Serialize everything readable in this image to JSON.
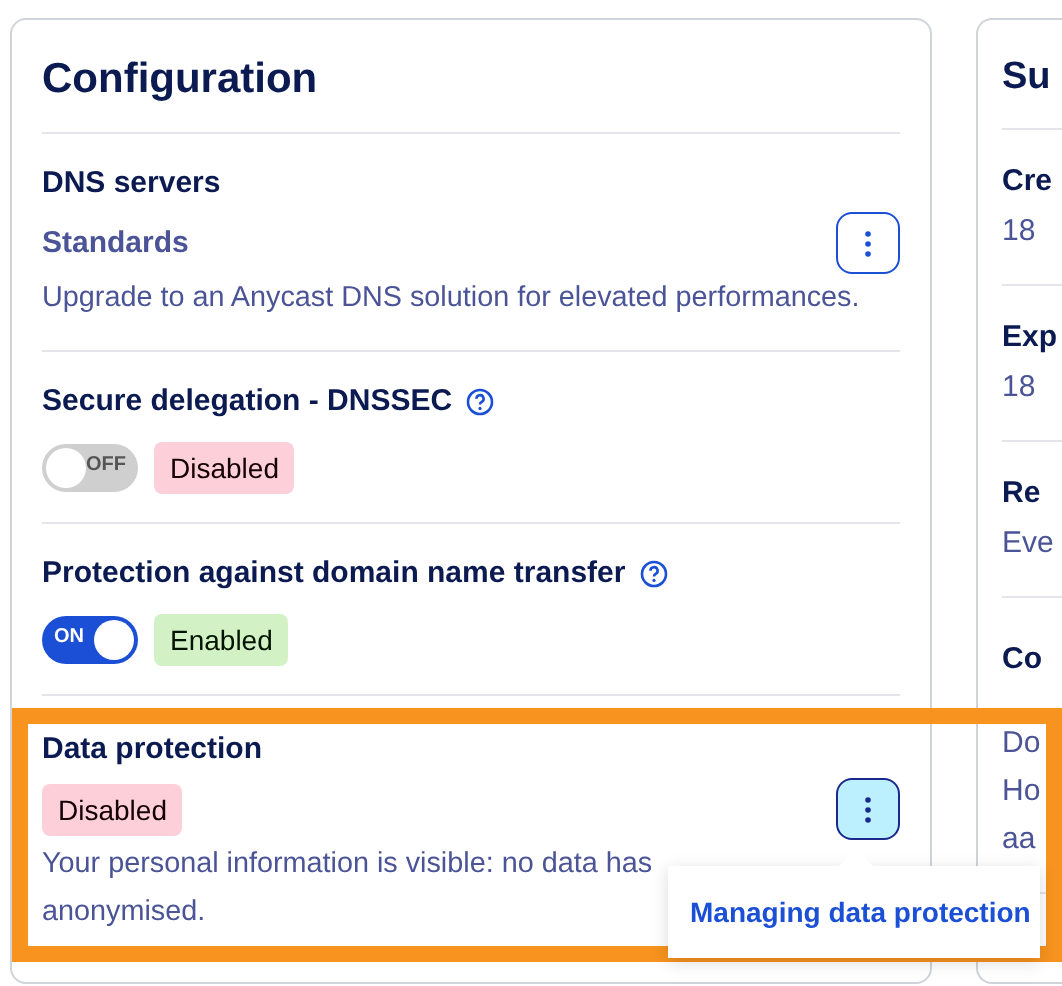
{
  "configuration": {
    "title": "Configuration",
    "sections": [
      {
        "kind": "menu",
        "title": "DNS servers",
        "subtitle": "Standards",
        "description_lines": [
          "Upgrade to an Anycast DNS solution for elevated performances."
        ],
        "menu": {
          "expanded": false
        }
      },
      {
        "kind": "toggle",
        "title": "Secure delegation - DNSSEC",
        "help": true,
        "toggle": {
          "on": false,
          "label": "OFF"
        },
        "badge": {
          "color": "#fdd0d9",
          "label": "Disabled"
        }
      },
      {
        "kind": "toggle",
        "title": "Protection against domain name transfer",
        "help": true,
        "toggle": {
          "on": true,
          "label": "ON"
        },
        "badge": {
          "color": "#d2f2c6",
          "label": "Enabled"
        }
      },
      {
        "kind": "badge-menu",
        "title": "Data protection",
        "highlighted": true,
        "badge": {
          "color": "#fdd0d9",
          "label": "Disabled"
        },
        "description_lines": [
          "Your personal information is visible: no data has",
          "anonymised."
        ],
        "menu": {
          "expanded": true,
          "items": [
            "Managing data protection"
          ]
        }
      }
    ]
  },
  "summary": {
    "title": "Su",
    "groups": [
      {
        "label": "Cre",
        "values": [
          "18"
        ]
      },
      {
        "label": "Exp",
        "values": [
          "18"
        ]
      },
      {
        "label": "Re",
        "values": [
          "Eve"
        ]
      },
      {
        "label": "Co",
        "values": [
          "Do",
          "Ho",
          "aa"
        ]
      }
    ]
  }
}
